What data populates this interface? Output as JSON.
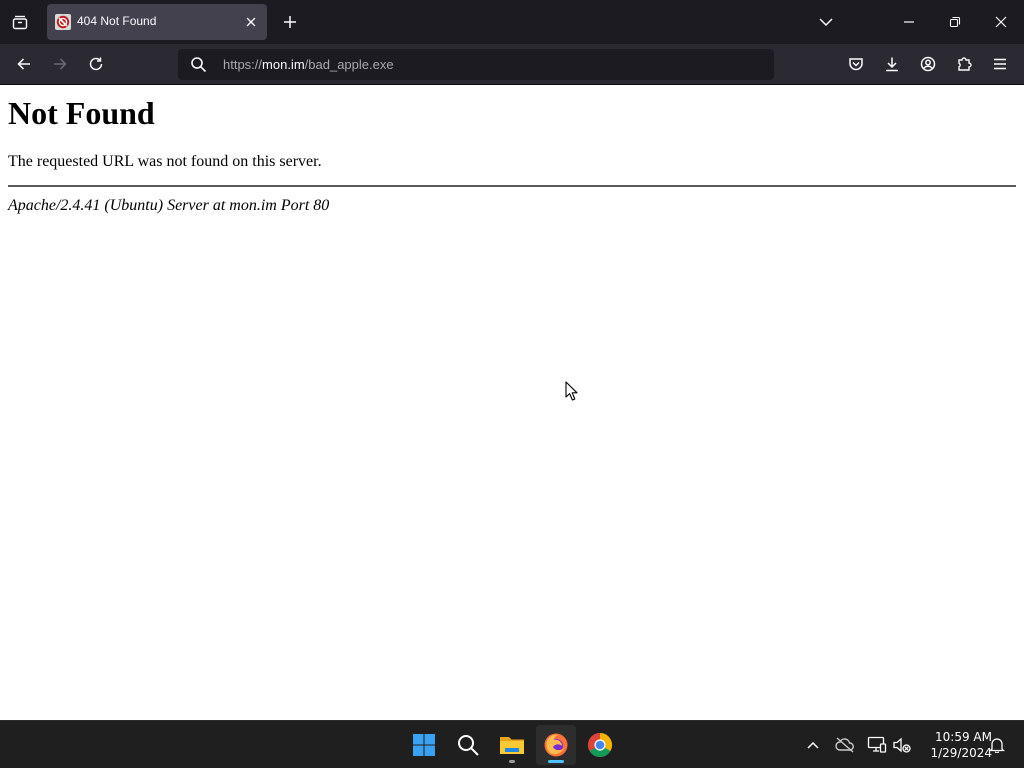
{
  "browser": {
    "tab": {
      "title": "404 Not Found",
      "favicon_icon": "stop-sign-favicon"
    },
    "url": {
      "scheme": "https://",
      "host": "mon.im",
      "path": "/bad_apple.exe"
    }
  },
  "page": {
    "heading": "Not Found",
    "message": "The requested URL was not found on this server.",
    "address": "Apache/2.4.41 (Ubuntu) Server at mon.im Port 80"
  },
  "taskbar": {
    "apps": [
      "windows-start",
      "search",
      "file-explorer",
      "firefox",
      "chrome"
    ],
    "clock": {
      "time": "10:59 AM",
      "date": "1/29/2024"
    }
  },
  "colors": {
    "tabstrip_bg": "#1c1b22",
    "toolbar_bg": "#2b2a33",
    "selected_tab_bg": "#42414d",
    "taskbar_bg": "#1f1f1f"
  }
}
